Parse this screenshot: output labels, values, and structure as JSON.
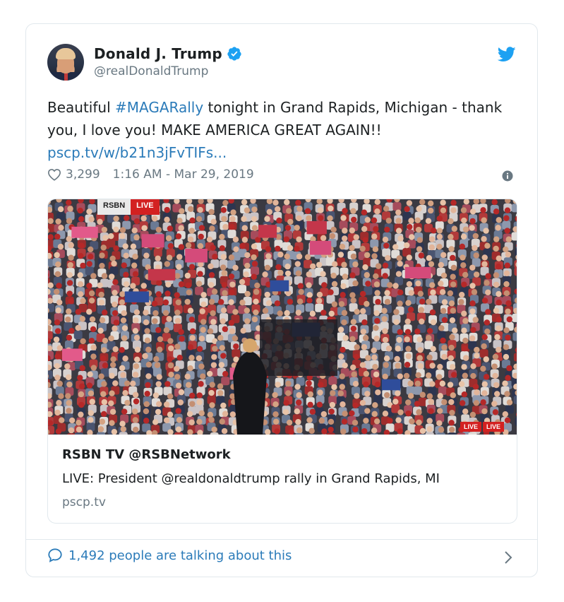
{
  "tweet": {
    "name": "Donald J. Trump",
    "handle": "@realDonaldTrump",
    "text_parts": [
      {
        "text": "Beautiful ",
        "link": false
      },
      {
        "text": "#MAGARally",
        "link": true
      },
      {
        "text": " tonight in Grand Rapids, Michigan - thank you, I love you! MAKE AMERICA GREAT AGAIN!! ",
        "link": false
      },
      {
        "text": "pscp.tv/w/b21n3jFvTIFs...",
        "link": true
      }
    ],
    "likes": "3,299",
    "timestamp": "1:16 AM - Mar 29, 2019"
  },
  "media": {
    "overlay_brand": "RSBN",
    "overlay_live": "LIVE",
    "corner_live_1": "LIVE",
    "corner_live_2": "LIVE",
    "card_title": "RSBN TV @RSBNetwork",
    "card_description": "LIVE: President @realdonaldtrump rally in Grand Rapids, MI",
    "card_domain": "pscp.tv"
  },
  "footer": {
    "talking": "1,492 people are talking about this"
  },
  "colors": {
    "link": "#2b7bb9",
    "secondary": "#697882",
    "verified": "#1da1f2",
    "border": "#e1e8ed"
  },
  "icons": {
    "verified": "verified-badge-icon",
    "bird": "twitter-bird-icon",
    "heart": "heart-icon",
    "info": "info-icon",
    "bubble": "speech-bubble-icon",
    "chevron": "chevron-right-icon"
  }
}
